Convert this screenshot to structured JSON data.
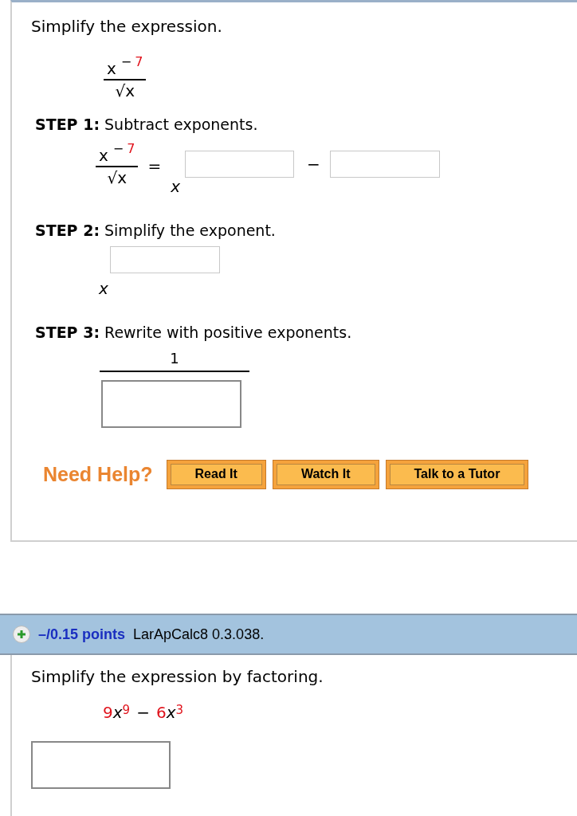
{
  "question_1": {
    "prompt": "Simplify the expression.",
    "expression": {
      "base": "x",
      "exponent_sign": "−",
      "exponent_value": "7",
      "denominator": "√x"
    },
    "steps": [
      {
        "kind": "subtract",
        "label": "STEP 1:",
        "instruction": "Subtract exponents.",
        "fraction": {
          "base": "x",
          "exponent_sign": "−",
          "exponent_value": "7",
          "denominator": "√x"
        },
        "equals": "=",
        "result_base": "x",
        "operator": "−"
      },
      {
        "kind": "simplify",
        "label": "STEP 2:",
        "instruction": "Simplify the exponent.",
        "result_base": "x"
      },
      {
        "kind": "reciprocal",
        "label": "STEP 3:",
        "instruction": "Rewrite with positive exponents.",
        "numerator": "1"
      }
    ],
    "help": {
      "label": "Need Help?",
      "buttons": [
        "Read It",
        "Watch It",
        "Talk to a Tutor"
      ]
    }
  },
  "question_2": {
    "points": "–/0.15 points",
    "source": "LarApCalc8 0.3.038.",
    "prompt": "Simplify the expression by factoring.",
    "expression": [
      {
        "kind": "number",
        "text": "9"
      },
      {
        "kind": "variable",
        "text": "x"
      },
      {
        "kind": "exponent",
        "text": "9"
      },
      {
        "kind": "operator",
        "text": "−"
      },
      {
        "kind": "number",
        "text": "6"
      },
      {
        "kind": "variable",
        "text": "x"
      },
      {
        "kind": "exponent",
        "text": "3"
      }
    ]
  }
}
